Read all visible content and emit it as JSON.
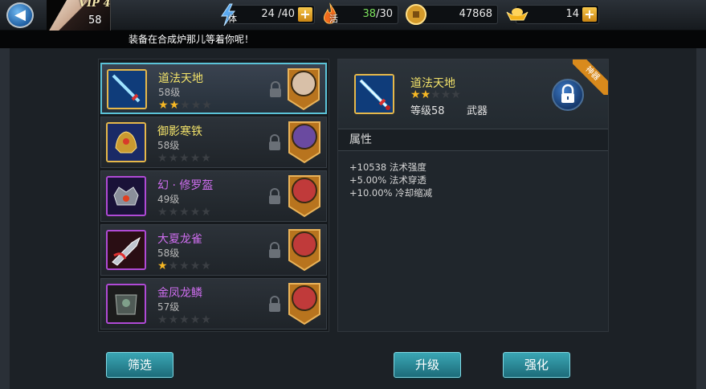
{
  "topbar": {
    "vip": "VIP 4",
    "player_level": "58",
    "stamina": {
      "value": "24 /40",
      "tag": "体"
    },
    "energy": {
      "current": "38",
      "max": "/30",
      "tag": "活"
    },
    "coins": {
      "value": "47868"
    },
    "gold": {
      "value": "14"
    },
    "plus_symbol": "+",
    "back_symbol": "◀"
  },
  "banner": {
    "text": "装备在合成炉那儿等着你呢！"
  },
  "equipment_list": [
    {
      "name": "道法天地",
      "level": "58级",
      "stars": 2,
      "rarity": "gold",
      "name_color": "#f3e36a"
    },
    {
      "name": "御影寒铁",
      "level": "58级",
      "stars": 0,
      "rarity": "gold",
      "name_color": "#f3e36a"
    },
    {
      "name": "幻 · 修罗盔",
      "level": "49级",
      "stars": 0,
      "rarity": "purple",
      "name_color": "#cf6ef0"
    },
    {
      "name": "大夏龙雀",
      "level": "58级",
      "stars": 1,
      "rarity": "purple",
      "name_color": "#cf6ef0"
    },
    {
      "name": "金凤龙鳞",
      "level": "57级",
      "stars": 0,
      "rarity": "purple",
      "name_color": "#cf6ef0"
    }
  ],
  "filter_button": "筛选",
  "detail": {
    "name": "道法天地",
    "stars": 2,
    "level_text": "等级58",
    "type": "武器",
    "corner_tag": "神器",
    "attributes_title": "属性",
    "attributes": [
      "+10538 法术强度",
      "+5.00% 法术穿透",
      "+10.00% 冷却缩减"
    ],
    "upgrade_button": "升级",
    "enhance_button": "强化"
  },
  "icons": {
    "back": "back-arrow-icon",
    "stamina": "lightning-icon",
    "energy": "flame-icon",
    "coin": "coin-icon",
    "gold": "gold-ingot-icon",
    "lock": "lock-icon"
  }
}
